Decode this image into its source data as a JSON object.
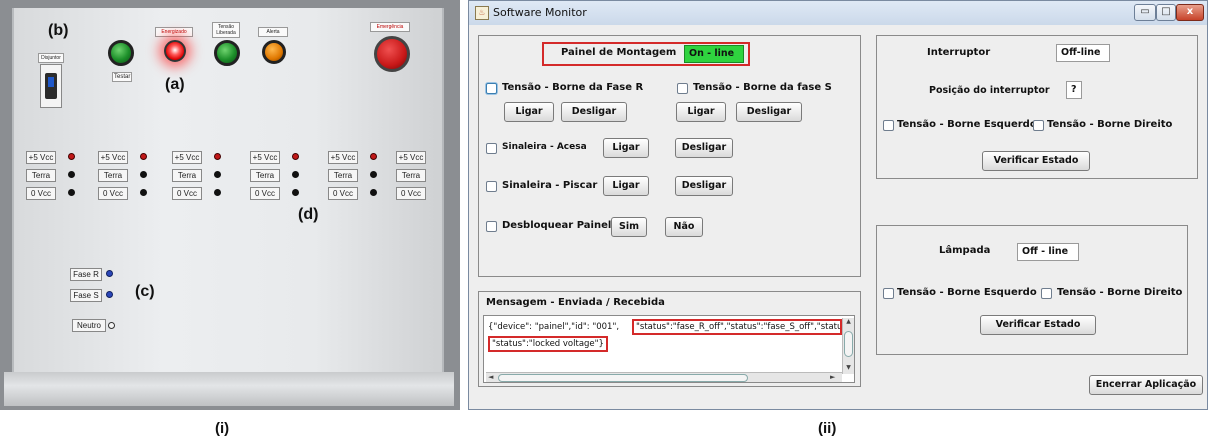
{
  "figure_labels": {
    "left": "(i)",
    "right": "(ii)"
  },
  "panel_photo": {
    "markers": {
      "a": "(a)",
      "b": "(b)",
      "c": "(c)",
      "d": "(d)"
    },
    "breaker_label": "Disjuntor",
    "test_label": "Testar",
    "lamp_labels": [
      "Energizado",
      "Tensão Liberada",
      "Alerta",
      "Emergência"
    ],
    "terminal_labels": [
      "+5 Vcc",
      "Terra",
      "0 Vcc"
    ],
    "phase_labels": [
      "Fase R",
      "Fase S",
      "Neutro"
    ]
  },
  "window": {
    "title": "Software Monitor",
    "controls": {
      "minimize": "▭",
      "maximize": "□",
      "close": "x"
    },
    "painel": {
      "label": "Painel de Montagem",
      "status": "On - line",
      "fase_r": {
        "label": "Tensão - Borne da Fase R",
        "on": "Ligar",
        "off": "Desligar"
      },
      "fase_s": {
        "label": "Tensão - Borne da fase S",
        "on": "Ligar",
        "off": "Desligar"
      },
      "sinaleira_acesa": {
        "label": "Sinaleira - Acesa",
        "on": "Ligar",
        "off": "Desligar"
      },
      "sinaleira_piscar": {
        "label": "Sinaleira - Piscar",
        "on": "Ligar",
        "off": "Desligar"
      },
      "desbloquear": {
        "label": "Desbloquear Painel",
        "yes": "Sim",
        "no": "Não"
      }
    },
    "mensagem": {
      "title": "Mensagem - Enviada / Recebida",
      "line1_pre": "{\"device\": \"painel\",\"id\": \"001\",",
      "line1_hl": "\"status\":\"fase_R_off\",\"status\":\"fase_S_off\",\"statu",
      "line2_hl": "\"status\":\"locked voltage\"}"
    },
    "interruptor": {
      "label": "Interruptor",
      "status": "Off-line",
      "posicao_label": "Posição do interruptor",
      "posicao_value": "?",
      "esquerdo": "Tensão - Borne Esquerdo",
      "direito": "Tensão - Borne Direito",
      "verificar": "Verificar Estado"
    },
    "lampada": {
      "label": "Lâmpada",
      "status": "Off - line",
      "esquerdo": "Tensão - Borne Esquerdo",
      "direito": "Tensão - Borne Direito",
      "verificar": "Verificar Estado"
    },
    "encerrar": "Encerrar Aplicação"
  }
}
